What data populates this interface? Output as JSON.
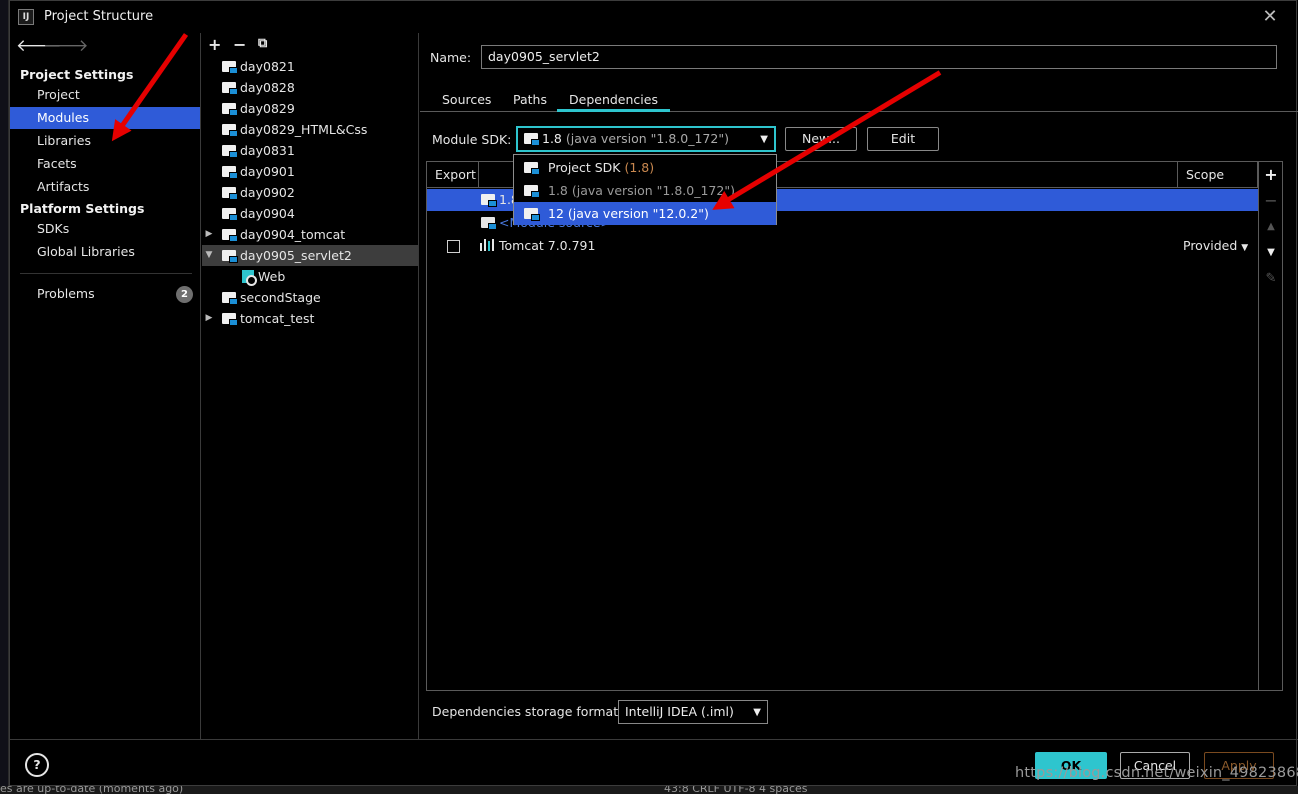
{
  "window": {
    "app_icon": "IJ",
    "title": "Project Structure",
    "close_icon": "close-icon"
  },
  "sidebar": {
    "back_icon": "arrow-left-icon",
    "forward_icon": "arrow-right-icon",
    "project_settings": "Project Settings",
    "platform_settings": "Platform Settings",
    "items": {
      "project": "Project",
      "modules": "Modules",
      "libraries": "Libraries",
      "facets": "Facets",
      "artifacts": "Artifacts",
      "sdks": "SDKs",
      "global_libraries": "Global Libraries",
      "problems": "Problems"
    },
    "problems_count": "2",
    "selected": "Modules"
  },
  "modules_panel": {
    "toolbar": {
      "add": "+",
      "remove": "−",
      "copy_icon": "copy-icon"
    },
    "tree": [
      "day0821",
      "day0828",
      "day0829",
      "day0829_HTML&Css",
      "day0831",
      "day0901",
      "day0902",
      "day0904",
      "day0904_tomcat",
      "day0905_servlet2",
      "Web",
      "secondStage",
      "tomcat_test"
    ],
    "selected": "day0905_servlet2"
  },
  "module": {
    "name_label": "Name:",
    "name_value": "day0905_servlet2",
    "tabs": [
      "Sources",
      "Paths",
      "Dependencies"
    ],
    "active_tab": "Dependencies",
    "sdk_label": "Module SDK:",
    "sdk_selected": "1.8",
    "sdk_selected_detail": "(java version \"1.8.0_172\")",
    "new_button": "New...",
    "edit_button": "Edit",
    "sdk_options": [
      {
        "name": "Project SDK",
        "detail": "(1.8)"
      },
      {
        "name": "1.8",
        "detail": "(java version \"1.8.0_172\")"
      },
      {
        "name": "12",
        "detail": "(java version \"12.0.2\")"
      }
    ],
    "highlighted_option": "12 (java version \"12.0.2\")",
    "table": {
      "columns": [
        "Export",
        "Scope"
      ],
      "rows": [
        {
          "name": "1.8",
          "scope": ""
        },
        {
          "name": "<Module source>",
          "scope": ""
        },
        {
          "name": "Tomcat 7.0.791",
          "scope": "Provided"
        }
      ]
    },
    "storage_label": "Dependencies storage format:",
    "storage_value": "IntelliJ IDEA (.iml)"
  },
  "footer": {
    "help": "?",
    "ok": "OK",
    "cancel": "Cancel",
    "apply": "Apply"
  },
  "statusbar": {
    "left": "es are up-to-date (moments ago)",
    "right": "43:8   CRLF   UTF-8   4 spaces"
  },
  "watermark": "https://blog.csdn.net/weixin_49823868",
  "colors": {
    "accent": "#2ec5ce",
    "selection": "#2f5bd8",
    "annotation_arrow": "#e60000",
    "version_text": "#c9884f"
  }
}
